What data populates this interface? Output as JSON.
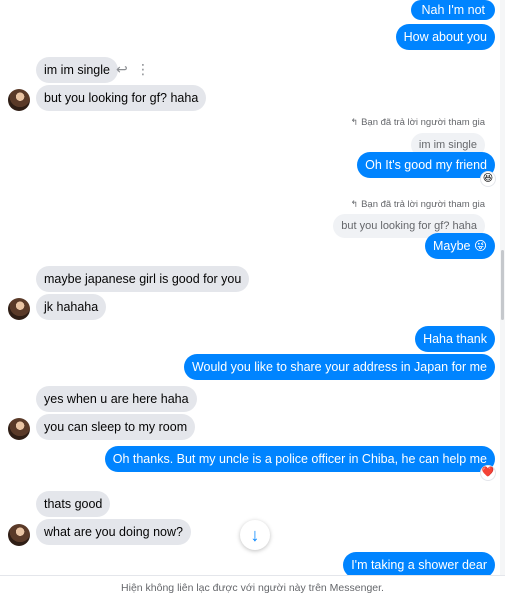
{
  "conversation": {
    "m1": "Nah I'm not",
    "m2": "How about you",
    "m3": "im im single",
    "m4": "but you looking for gf? haha",
    "reply_note_1": "Bạn đã trả lời người tham gia",
    "quote_1": "im im single",
    "m5": "Oh It's good my friend",
    "reply_note_2": "Bạn đã trả lời người tham gia",
    "quote_2": "but you looking for gf? haha",
    "m6": "Maybe 😜",
    "m7": "maybe japanese girl is good for you",
    "m8": "jk hahaha",
    "m9": "Haha thank",
    "m10": "Would you like to share your address in Japan for me",
    "m11": "yes when u are here haha",
    "m12": "you can sleep to my room",
    "m13": "Oh thanks. But my uncle is a police officer in Chiba, he can help me",
    "m14": "thats good",
    "m15": "what are you doing now?",
    "m16": "I'm taking a shower dear"
  },
  "reactions": {
    "r1": "😆",
    "r2": "❤️"
  },
  "icons": {
    "reply": "↩",
    "more": "⋮",
    "scroll_down": "↓",
    "reply_note": "↰"
  },
  "footer": {
    "status": "Hiện không liên lạc được với người này trên Messenger."
  },
  "colors": {
    "outgoing": "#0084ff",
    "incoming": "#e4e6eb",
    "text_secondary": "#65676b"
  }
}
